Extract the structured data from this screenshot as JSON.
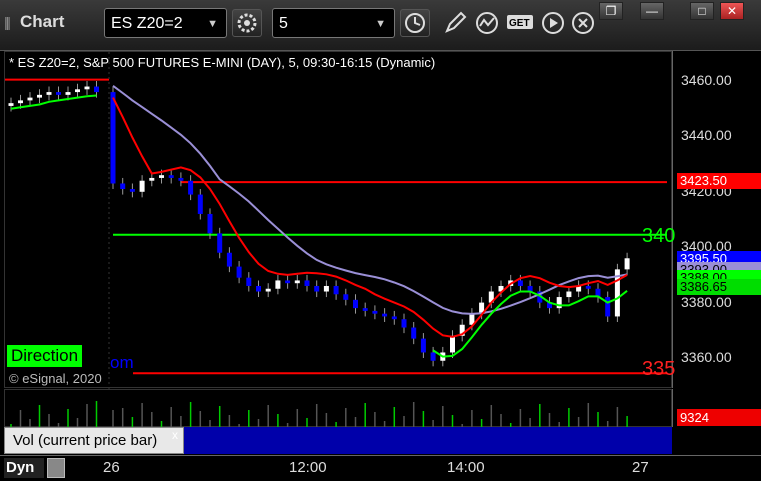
{
  "window": {
    "title": "Chart",
    "symbol": "ES Z20=2",
    "interval": "5",
    "restore_label": "❐",
    "minimize_label": "—",
    "maximize_label": "□",
    "close_label": "✕"
  },
  "toolbar_icons": [
    "gear-icon",
    "clock-icon",
    "pencil-icon",
    "study-icon",
    "get-icon",
    "play-icon",
    "circle-x-icon"
  ],
  "chart": {
    "description": "* ES Z20=2, S&P 500 FUTURES E-MINI (DAY), 5, 09:30-16:15 (Dynamic)",
    "direction_label": "Direction",
    "copyright": "© eSignal, 2020",
    "watermark_fragment": "om",
    "level_labels": {
      "upper": "340",
      "lower": "335"
    },
    "price_ticks": [
      "3460.00",
      "3440.00",
      "3420.00",
      "3400.00",
      "3380.00",
      "3360.00"
    ],
    "price_tags": [
      {
        "label": "3423.50",
        "color": "#ff0000",
        "text_color": "#ffffff"
      },
      {
        "label": "3395.50",
        "color": "#0000ff",
        "text_color": "#ffffff"
      },
      {
        "label": "3393.00",
        "color": "#9a8fd6",
        "text_color": "#000000"
      },
      {
        "label": "3388.00",
        "color": "#00ff00",
        "text_color": "#000000"
      },
      {
        "label": "3386.65",
        "color": "#00dd00",
        "text_color": "#000000"
      }
    ],
    "colors": {
      "up": "#ffffff",
      "down": "#0000ff",
      "ma_red": "#ff0000",
      "ma_green": "#00ff00",
      "ma_purple": "#9a8fd6",
      "level_red": "#ff0000",
      "level_green": "#00ff00"
    }
  },
  "volume": {
    "last_value": "9324",
    "legend": "Vol (current price bar)",
    "close_label": "x"
  },
  "time_axis": {
    "dyn_label": "Dyn",
    "labels": [
      "26",
      "12:00",
      "14:00",
      "27"
    ]
  },
  "chart_data": {
    "type": "candlestick",
    "ylim": [
      3350,
      3470
    ],
    "levels": [
      {
        "name": "",
        "value": 3423.5,
        "color": "#ff0000"
      },
      {
        "name": "",
        "value": 3404.5,
        "color": "#00ff00"
      },
      {
        "name": "",
        "value": 3354.5,
        "color": "#ff0000"
      },
      {
        "name": "",
        "value": 3460.5,
        "color": "#ff0000"
      }
    ],
    "closes": [
      3452,
      3453,
      3454,
      3455,
      3456,
      3455,
      3456,
      3457,
      3458,
      3456,
      3423,
      3421,
      3420,
      3424,
      3425,
      3426,
      3425,
      3424,
      3419,
      3412,
      3405,
      3398,
      3393,
      3389,
      3386,
      3384,
      3385,
      3388,
      3387,
      3388,
      3386,
      3384,
      3386,
      3383,
      3381,
      3378,
      3377,
      3376,
      3375,
      3374,
      3371,
      3367,
      3362,
      3359,
      3362,
      3368,
      3372,
      3376,
      3380,
      3384,
      3386,
      3388,
      3386,
      3384,
      3380,
      3378,
      3382,
      3384,
      3386,
      3385,
      3382,
      3375,
      3392,
      3396
    ]
  }
}
